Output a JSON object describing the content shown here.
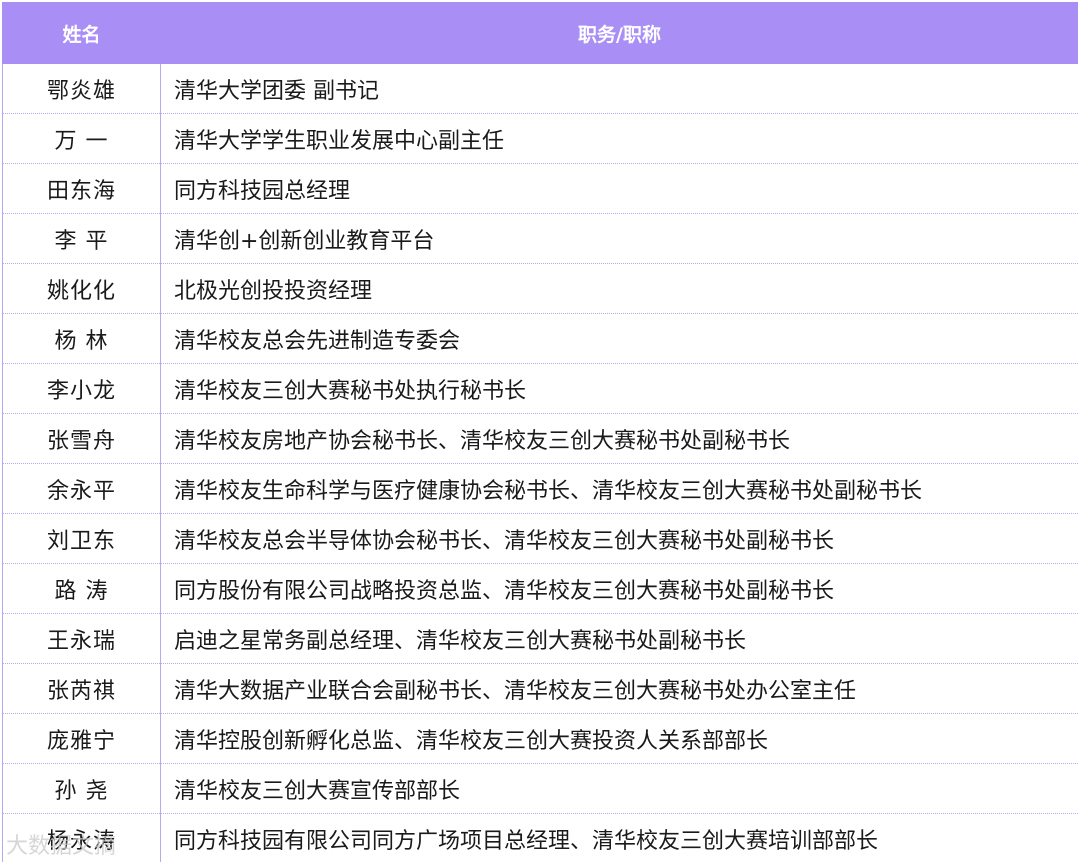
{
  "table": {
    "headers": [
      "姓名",
      "职务/职称"
    ],
    "rows": [
      [
        "鄂炎雄",
        "清华大学团委 副书记"
      ],
      [
        "万  一",
        "清华大学学生职业发展中心副主任"
      ],
      [
        "田东海",
        "同方科技园总经理"
      ],
      [
        "李  平",
        "清华创+创新创业教育平台"
      ],
      [
        "姚化化",
        "北极光创投投资经理"
      ],
      [
        "杨  林",
        "清华校友总会先进制造专委会"
      ],
      [
        "李小龙",
        "清华校友三创大赛秘书处执行秘书长"
      ],
      [
        "张雪舟",
        "清华校友房地产协会秘书长、清华校友三创大赛秘书处副秘书长"
      ],
      [
        "余永平",
        "清华校友生命科学与医疗健康协会秘书长、清华校友三创大赛秘书处副秘书长"
      ],
      [
        "刘卫东",
        "清华校友总会半导体协会秘书长、清华校友三创大赛秘书处副秘书长"
      ],
      [
        "路  涛",
        "同方股份有限公司战略投资总监、清华校友三创大赛秘书处副秘书长"
      ],
      [
        "王永瑞",
        "启迪之星常务副总经理、清华校友三创大赛秘书处副秘书长"
      ],
      [
        "张芮祺",
        "清华大数据产业联合会副秘书长、清华校友三创大赛秘书处办公室主任"
      ],
      [
        "庞雅宁",
        "清华控股创新孵化总监、清华校友三创大赛投资人关系部部长"
      ],
      [
        "孙  尧",
        "清华校友三创大赛宣传部部长"
      ],
      [
        "杨永涛",
        "同方科技园有限公司同方广场项目总经理、清华校友三创大赛培训部部长"
      ]
    ]
  },
  "colors": {
    "header_bg": "#a98ff5",
    "border": "#b8a8ef"
  },
  "watermark": "大数据文摘"
}
